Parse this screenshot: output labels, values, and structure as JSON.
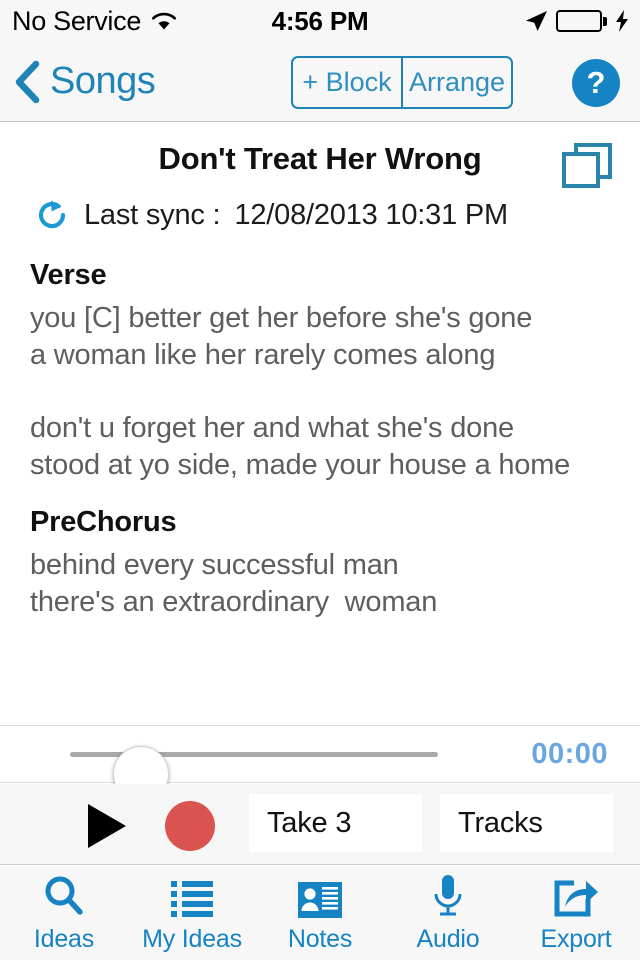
{
  "status_bar": {
    "carrier": "No Service",
    "wifi_icon": "wifi-icon",
    "time": "4:56 PM",
    "location_icon": "location-arrow-icon",
    "battery_icon": "battery-full-icon",
    "charging_icon": "lightning-bolt-icon",
    "battery_color": "#4cd964"
  },
  "nav_bar": {
    "back_icon": "chevron-left-icon",
    "back_label": "Songs",
    "segmented": [
      {
        "label": "+ Block"
      },
      {
        "label": "Arrange"
      }
    ],
    "help_label": "?",
    "accent_color": "#1e84b5"
  },
  "content": {
    "song_title": "Don't Treat Her Wrong",
    "copy_icon": "copy-pages-icon",
    "sync_icon": "refresh-sync-icon",
    "sync_label": "Last sync :",
    "sync_value": "12/08/2013 10:31 PM",
    "sections": [
      {
        "heading": "Verse",
        "body": "you [C] better get her before she's gone\na woman like her rarely comes along\n\ndon't u forget her and what she's done\nstood at yo side, made your house a home"
      },
      {
        "heading": "PreChorus",
        "body": "behind every successful man\nthere's an extraordinary  woman"
      }
    ]
  },
  "scrubber": {
    "position_percent": 0,
    "time_label": "00:00",
    "time_color": "#6aa6e0"
  },
  "transport": {
    "play_icon": "play-icon",
    "record_icon": "record-icon",
    "record_color": "#d9534f",
    "take_label": "Take 3",
    "tracks_label": "Tracks"
  },
  "tab_bar": {
    "tabs": [
      {
        "label": "Ideas",
        "icon": "search-icon"
      },
      {
        "label": "My Ideas",
        "icon": "list-icon"
      },
      {
        "label": "Notes",
        "icon": "contact-card-icon"
      },
      {
        "label": "Audio",
        "icon": "microphone-icon"
      },
      {
        "label": "Export",
        "icon": "share-export-icon"
      }
    ],
    "tint_color": "#1583c4"
  }
}
